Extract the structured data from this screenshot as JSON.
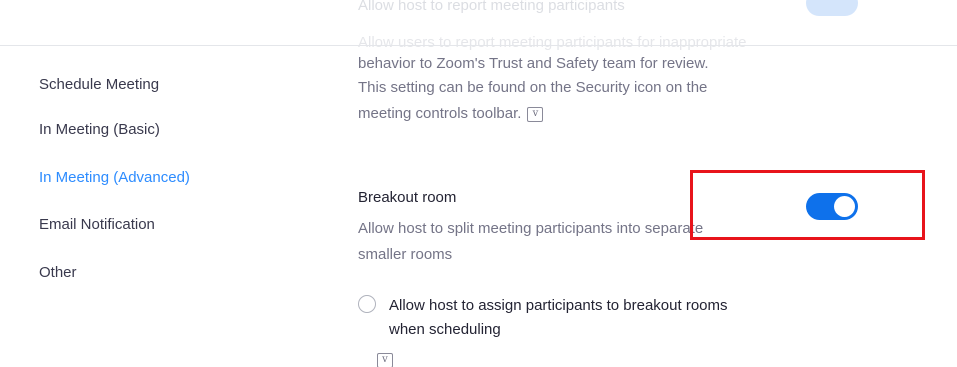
{
  "faded_top": {
    "line1": "Allow host to report meeting participants",
    "line2": "Allow users to report meeting participants for inappropriate"
  },
  "sidebar": {
    "items": [
      {
        "label": "Schedule Meeting",
        "active": false
      },
      {
        "label": "In Meeting (Basic)",
        "active": false
      },
      {
        "label": "In Meeting (Advanced)",
        "active": true
      },
      {
        "label": "Email Notification",
        "active": false
      },
      {
        "label": "Other",
        "active": false
      }
    ]
  },
  "report_setting": {
    "desc_line1": "behavior to Zoom's Trust and Safety team for review.",
    "desc_line2": "This setting can be found on the Security icon on the",
    "desc_line3": "meeting controls toolbar.",
    "version_icon": "v"
  },
  "breakout_room": {
    "title": "Breakout room",
    "desc_line1": "Allow host to split meeting participants into separate",
    "desc_line2": "smaller rooms",
    "toggle_on": true,
    "option_label_line1": "Allow host to assign participants to breakout rooms",
    "option_label_line2": "when scheduling",
    "option_checked": false,
    "version_icon": "v"
  },
  "colors": {
    "accent": "#0e71eb",
    "active_nav": "#2d8cff",
    "highlight_box": "#e8141b"
  }
}
